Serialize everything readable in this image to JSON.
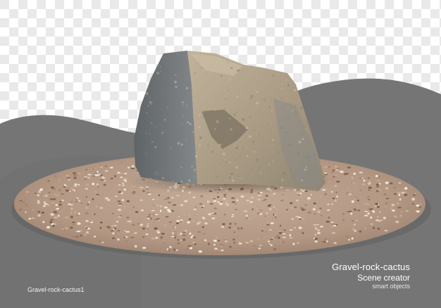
{
  "scene": {
    "subject": "rock-on-gravel-bed",
    "background": "transparency-checkerboard",
    "colors": {
      "checker_light": "#ffffff",
      "checker_dark": "#e9e9e9",
      "gray_panel": "#757575",
      "gravel_base": "#b49a86",
      "rock_shadow_side": "#6f7376",
      "rock_lit_side": "#b2a58f"
    }
  },
  "caption": {
    "title": "Gravel-rock-cactus",
    "subtitle": "Scene creator",
    "tag": "smart objects"
  },
  "file_label": "Gravel-rock-cactus1"
}
